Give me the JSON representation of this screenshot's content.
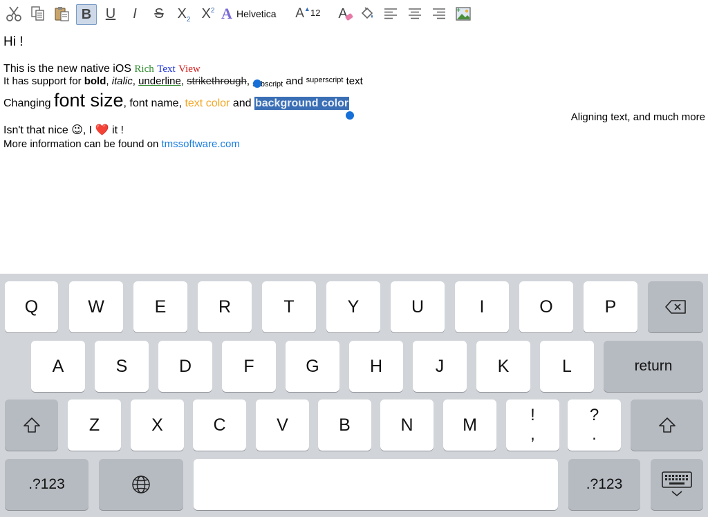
{
  "toolbar": {
    "tools": [
      {
        "id": "cut",
        "icon": "scissors-icon"
      },
      {
        "id": "copy",
        "icon": "copy-icon"
      },
      {
        "id": "paste",
        "icon": "paste-icon"
      },
      {
        "id": "bold",
        "label": "B",
        "active": true
      },
      {
        "id": "underline",
        "label": "U"
      },
      {
        "id": "italic",
        "label": "I"
      },
      {
        "id": "strikethrough",
        "label": "S"
      },
      {
        "id": "subscript",
        "label": "X",
        "mark": "2"
      },
      {
        "id": "superscript",
        "label": "X",
        "mark": "2"
      },
      {
        "id": "font",
        "icon": "font-icon"
      },
      {
        "id": "font-size",
        "icon": "font-size-icon"
      },
      {
        "id": "text-color",
        "icon": "text-color-icon"
      },
      {
        "id": "background-color",
        "icon": "fill-bucket-icon"
      },
      {
        "id": "align-left",
        "icon": "align-left-icon"
      },
      {
        "id": "align-center",
        "icon": "align-center-icon"
      },
      {
        "id": "align-right",
        "icon": "align-right-icon"
      },
      {
        "id": "insert-image",
        "icon": "insert-image-icon"
      }
    ],
    "bold_label": "B",
    "underline_label": "U",
    "italic_label": "I",
    "strike_label": "S",
    "sub_label": "X",
    "sub_mark": "2",
    "sup_label": "X",
    "sup_mark": "2",
    "font_name": "Helvetica",
    "font_size_glyph": "A",
    "font_size": "12",
    "text_color_glyph": "A"
  },
  "document": {
    "greeting": "Hi !",
    "line1": {
      "prefix": "This is the new native iOS ",
      "rich": "Rich",
      "text": "Text",
      "view": "View"
    },
    "line2": {
      "prefix": "It has support for ",
      "bold": "bold",
      "sep1": ", ",
      "italic": "italic",
      "sep2": ", ",
      "underline": "underline",
      "sep3": ", ",
      "strike": "strikethrough",
      "sep4": ", ",
      "subscript": "subscript",
      "and": " and ",
      "superscript": "superscript",
      "suffix": " text"
    },
    "line3": {
      "prefix": "Changing ",
      "big": "font size",
      "mid": ", font name, ",
      "color": "text color",
      "and": " and ",
      "bg": "background color"
    },
    "line4": "Aligning text, and much more",
    "line5": {
      "prefix": "Isn't that nice ",
      "mid": ", I ",
      "suffix": " it !",
      "emoji1": "😉",
      "emoji2": "❤️"
    },
    "line6": {
      "prefix": "More information can be found on ",
      "link": "tmssoftware.com"
    },
    "colors": {
      "rich": "#2e8b2e",
      "text": "#1a2fd6",
      "view": "#d22020",
      "text_color": "#f4a623",
      "selection_bg": "#3a6fb5",
      "link": "#1a7de0"
    }
  },
  "keyboard": {
    "row1": [
      "Q",
      "W",
      "E",
      "R",
      "T",
      "Y",
      "U",
      "I",
      "O",
      "P"
    ],
    "row2": [
      "A",
      "S",
      "D",
      "F",
      "G",
      "H",
      "J",
      "K",
      "L"
    ],
    "row3": [
      "Z",
      "X",
      "C",
      "V",
      "B",
      "N",
      "M"
    ],
    "return_label": "return",
    "excl_top": "!",
    "excl_bottom": ",",
    "q_top": "?",
    "q_bottom": ".",
    "num_left": ".?123",
    "num_right": ".?123",
    "icons": {
      "backspace": "backspace-icon",
      "shift": "shift-icon",
      "globe": "globe-icon",
      "hide": "keyboard-hide-icon"
    }
  }
}
